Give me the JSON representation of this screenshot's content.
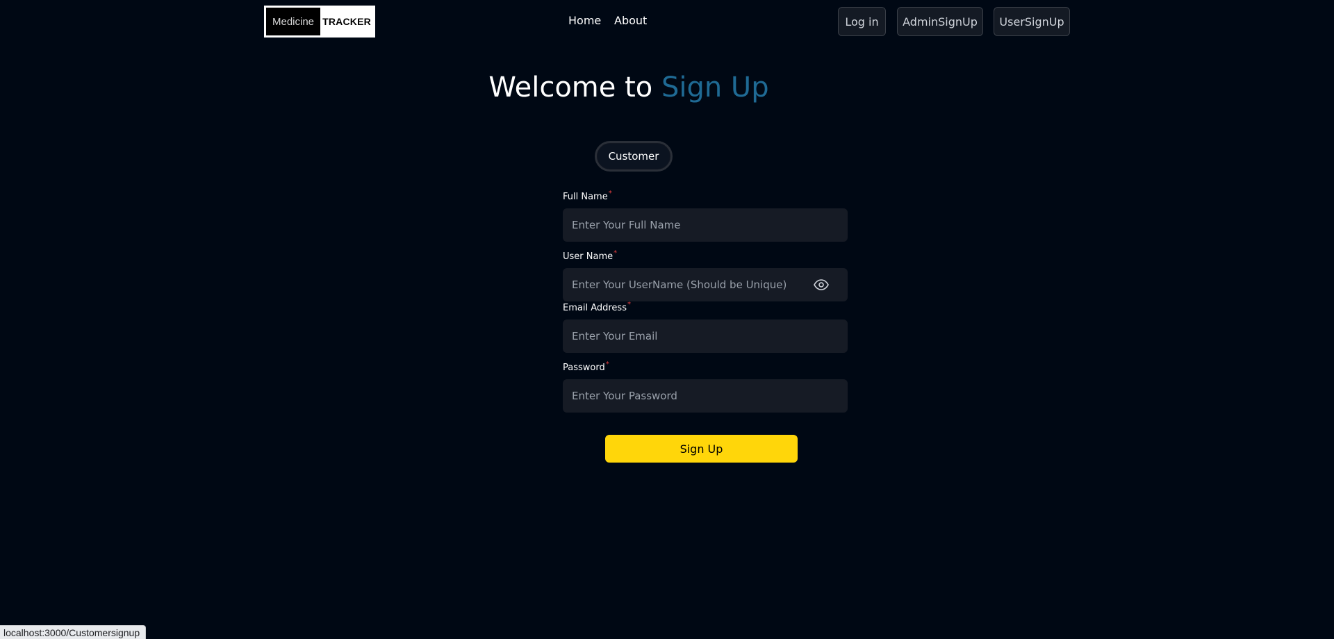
{
  "header": {
    "logo": {
      "left_text": "Medicine",
      "right_text": "TRACKER"
    },
    "nav": {
      "home": "Home",
      "about": "About"
    },
    "buttons": {
      "login": "Log in",
      "admin_signup": "AdminSignUp",
      "user_signup": "UserSignUp"
    }
  },
  "page": {
    "title_prefix": "Welcome to ",
    "title_accent": "Sign Up",
    "accent_color": "#1f6a94"
  },
  "tabs": {
    "customer": "Customer"
  },
  "form": {
    "full_name": {
      "label": "Full Name",
      "required_mark": "*",
      "placeholder": "Enter Your Full Name",
      "value": ""
    },
    "user_name": {
      "label": "User Name",
      "required_mark": "*",
      "placeholder": "Enter Your UserName (Should be Unique)",
      "value": "",
      "icon": "eye-icon"
    },
    "email": {
      "label": "Email Address",
      "required_mark": "*",
      "placeholder": "Enter Your Email",
      "value": ""
    },
    "password": {
      "label": "Password",
      "required_mark": "*",
      "placeholder": "Enter Your Password",
      "value": ""
    },
    "submit_label": "Sign Up",
    "submit_color": "#ffd60a"
  },
  "status_bar": {
    "url": "localhost:3000/Customersignup"
  },
  "colors": {
    "background": "#000814",
    "input_bg": "#161b25",
    "required": "#e53e3e"
  }
}
